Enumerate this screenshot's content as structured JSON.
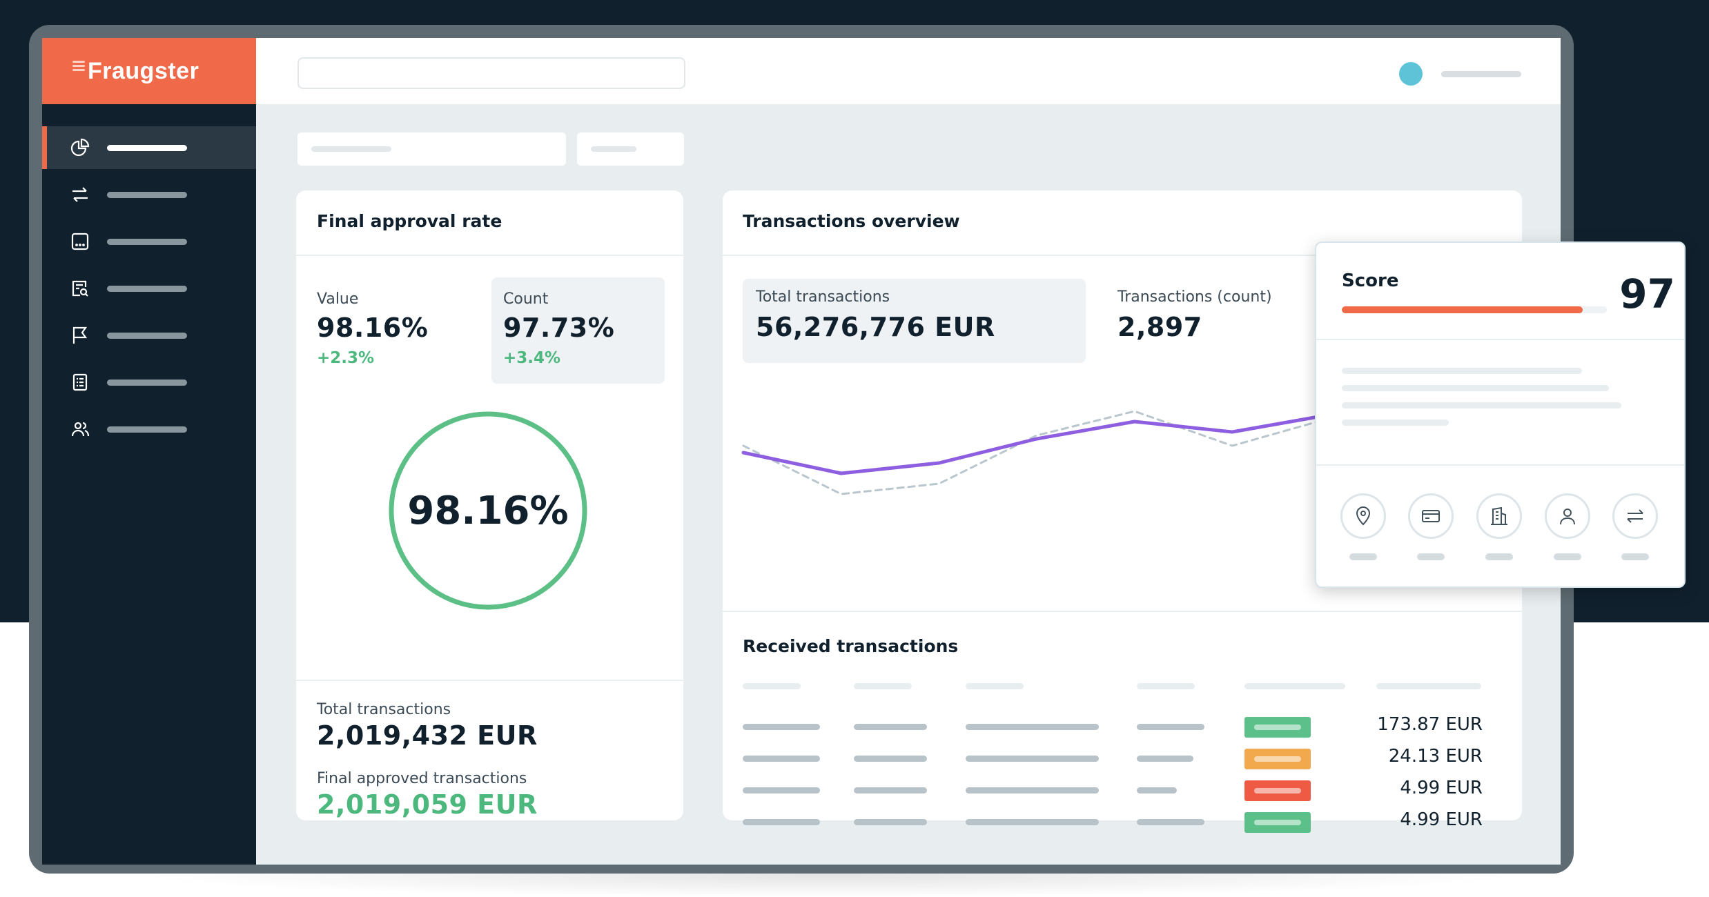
{
  "app": {
    "brand": "Fraugster"
  },
  "colors": {
    "brand": "#f06a4a",
    "sidebar": "#10202d",
    "positive": "#4cb87d",
    "line_primary": "#8e5ee0",
    "line_secondary": "#b9c6cd"
  },
  "sidebar": {
    "items": [
      {
        "icon": "pie-chart-icon",
        "active": true
      },
      {
        "icon": "arrows-exchange-icon",
        "active": false
      },
      {
        "icon": "message-box-icon",
        "active": false
      },
      {
        "icon": "report-search-icon",
        "active": false
      },
      {
        "icon": "flag-icon",
        "active": false
      },
      {
        "icon": "checklist-icon",
        "active": false
      },
      {
        "icon": "users-icon",
        "active": false
      }
    ]
  },
  "approval": {
    "title": "Final approval rate",
    "value_label": "Value",
    "value": "98.16%",
    "value_delta": "+2.3%",
    "count_label": "Count",
    "count": "97.73%",
    "count_delta": "+3.4%",
    "ring_value": "98.16%",
    "total_label": "Total transactions",
    "total": "2,019,432 EUR",
    "approved_label": "Final approved transactions",
    "approved": "2,019,059 EUR"
  },
  "overview": {
    "title": "Transactions overview",
    "total_label": "Total transactions",
    "total": "56,276,776 EUR",
    "count_label": "Transactions (count)",
    "count": "2,897"
  },
  "chart_data": {
    "type": "line",
    "title": "",
    "x": [
      0,
      1,
      2,
      3,
      4,
      5,
      6
    ],
    "series": [
      {
        "values": [
          52,
          40,
          46,
          60,
          70,
          64,
          74
        ]
      },
      {
        "values": [
          56,
          28,
          34,
          62,
          76,
          56,
          72
        ]
      }
    ],
    "ylim": [
      0,
      100
    ],
    "grid": false
  },
  "received": {
    "title": "Received transactions",
    "rows": [
      {
        "status": "approved",
        "status_color": "#5cc08a",
        "amount": "173.87 EUR"
      },
      {
        "status": "review",
        "status_color": "#f2a84c",
        "amount": "24.13 EUR"
      },
      {
        "status": "declined",
        "status_color": "#ee5a44",
        "amount": "4.99 EUR"
      },
      {
        "status": "approved",
        "status_color": "#5cc08a",
        "amount": "4.99 EUR"
      }
    ]
  },
  "score": {
    "title": "Score",
    "value": "97",
    "fill_fraction": 0.91,
    "icons": [
      "location-pin-icon",
      "credit-card-icon",
      "building-icon",
      "person-icon",
      "arrows-exchange-icon"
    ]
  }
}
